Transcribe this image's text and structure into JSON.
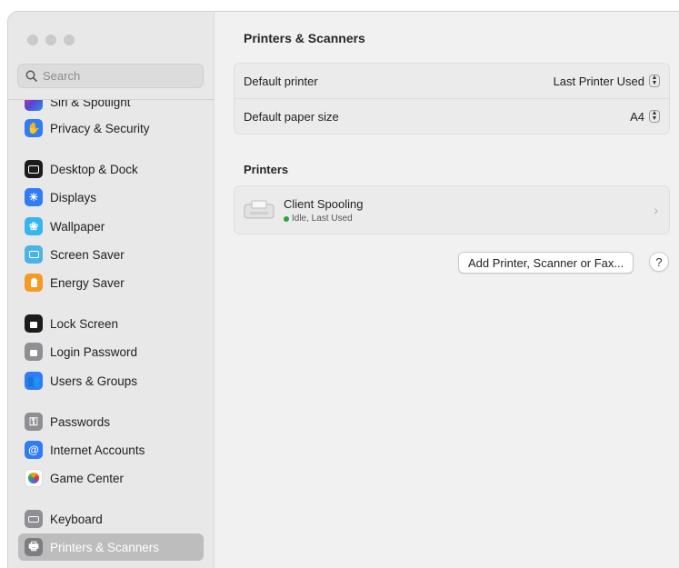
{
  "search": {
    "placeholder": "Search"
  },
  "sidebar": {
    "items": [
      {
        "label": "Siri & Spotlight",
        "icon": "siri-icon"
      },
      {
        "label": "Privacy & Security",
        "icon": "hand-icon"
      },
      {
        "label": "Desktop & Dock",
        "icon": "dock-icon"
      },
      {
        "label": "Displays",
        "icon": "sun-icon"
      },
      {
        "label": "Wallpaper",
        "icon": "flower-icon"
      },
      {
        "label": "Screen Saver",
        "icon": "screen-saver-icon"
      },
      {
        "label": "Energy Saver",
        "icon": "bulb-icon"
      },
      {
        "label": "Lock Screen",
        "icon": "lock-icon"
      },
      {
        "label": "Login Password",
        "icon": "lock-small-icon"
      },
      {
        "label": "Users & Groups",
        "icon": "users-icon"
      },
      {
        "label": "Passwords",
        "icon": "key-icon"
      },
      {
        "label": "Internet Accounts",
        "icon": "at-icon"
      },
      {
        "label": "Game Center",
        "icon": "game-center-icon"
      },
      {
        "label": "Keyboard",
        "icon": "keyboard-icon"
      },
      {
        "label": "Printers & Scanners",
        "icon": "printer-icon",
        "selected": true
      }
    ]
  },
  "main": {
    "title": "Printers & Scanners",
    "settings": [
      {
        "label": "Default printer",
        "value": "Last Printer Used"
      },
      {
        "label": "Default paper size",
        "value": "A4"
      }
    ],
    "printers_heading": "Printers",
    "printers": [
      {
        "name": "Client Spooling",
        "status": "Idle, Last Used",
        "status_color": "#29a63b"
      }
    ],
    "add_button": "Add Printer, Scanner or Fax...",
    "help_label": "?"
  }
}
